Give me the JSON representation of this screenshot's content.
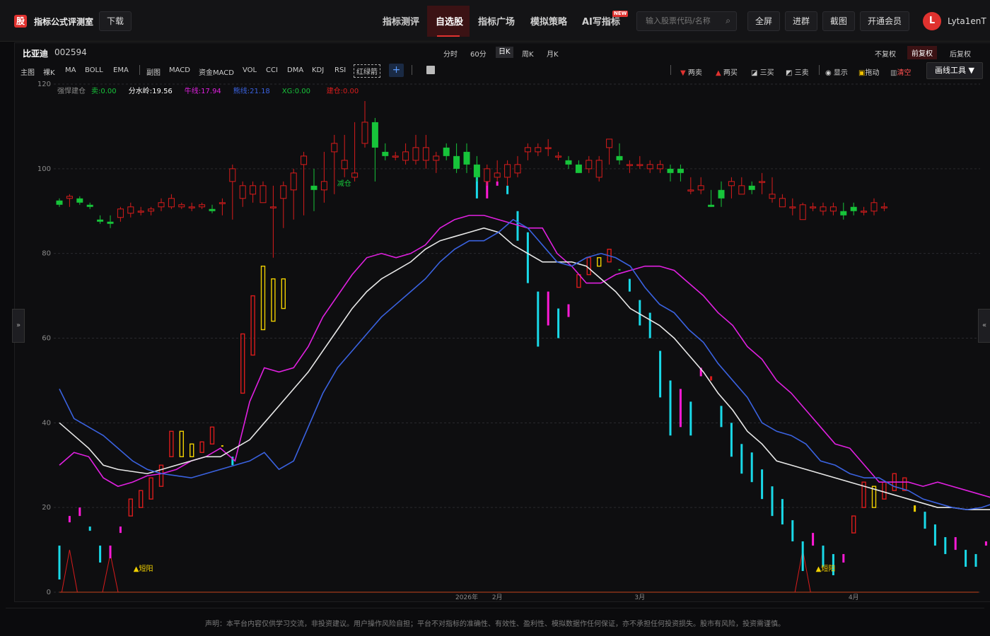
{
  "app": {
    "logo_char": "股",
    "title": "指标公式评测室",
    "download": "下载"
  },
  "nav": [
    {
      "label": "指标测评"
    },
    {
      "label": "自选股",
      "active": true
    },
    {
      "label": "指标广场"
    },
    {
      "label": "模拟策略"
    },
    {
      "label": "AI写指标",
      "badge": "NEW"
    }
  ],
  "search": {
    "placeholder": "输入股票代码/名称"
  },
  "top_actions": [
    "全屏",
    "进群",
    "截图",
    "开通会员"
  ],
  "user": {
    "avatar_letter": "L",
    "name": "Lyta1enT"
  },
  "stock": {
    "name": "比亚迪",
    "code": "002594"
  },
  "periods": [
    {
      "label": "分时"
    },
    {
      "label": "60分"
    },
    {
      "label": "日K",
      "active": true
    },
    {
      "label": "周K"
    },
    {
      "label": "月K"
    }
  ],
  "fuquan": [
    {
      "label": "不复权"
    },
    {
      "label": "前复权",
      "active": true
    },
    {
      "label": "后复权"
    }
  ],
  "indicators": [
    "主图",
    "裸K",
    "MA",
    "BOLL",
    "EMA",
    "副图",
    "MACD",
    "资金MACD",
    "VOL",
    "CCI",
    "DMA",
    "KDJ",
    "RSI",
    "红绿箭"
  ],
  "signal_tools": [
    "两卖",
    "两买",
    "三买",
    "三卖",
    "显示",
    "拖动",
    "清空"
  ],
  "draw_tool": "画线工具 ▼",
  "footer": "声明：本平台内容仅供学习交流，非投资建议。用户操作风险自担；平台不对指标的准确性、有效性、盈利性、模拟数据作任何保证，亦不承担任何投资损失。股市有风险，投资需谨慎。",
  "colors": {
    "up": "#d91c1c",
    "down": "#17c43a",
    "short": "#e020e0",
    "mid": "#e8e8e8",
    "long": "#3a62e0",
    "cyan": "#19d9e8",
    "magenta": "#ff1ad6",
    "yellow": "#f0d000",
    "accent": "#e0322f"
  },
  "chart_data": {
    "type": "line",
    "ylim": [
      0,
      120
    ],
    "yticks": [
      0,
      20,
      40,
      60,
      80,
      100,
      120
    ],
    "x_labels": [
      {
        "i": 40,
        "label": "2026年"
      },
      {
        "i": 43,
        "label": "2月"
      },
      {
        "i": 57,
        "label": "3月"
      },
      {
        "i": 78,
        "label": "4月"
      }
    ],
    "legend": [
      {
        "label": "强悍建仓",
        "value": "",
        "color": "#888888"
      },
      {
        "label": "卖:",
        "value": "0.00",
        "color": "#17c43a"
      },
      {
        "label": "分水岭:",
        "value": "19.56",
        "color": "#ffffff"
      },
      {
        "label": "牛线:",
        "value": "17.94",
        "color": "#e020e0"
      },
      {
        "label": "熊线:",
        "value": "21.18",
        "color": "#3a62e0"
      },
      {
        "label": "XG:",
        "value": "0.00",
        "color": "#17c43a"
      },
      {
        "label": "建仓:",
        "value": "0.00",
        "color": "#d91c1c"
      }
    ],
    "annotations": [
      {
        "i": 7,
        "y": 5,
        "text": "▲短阳",
        "color": "#f0d000"
      },
      {
        "i": 74,
        "y": 5,
        "text": "▲短阳",
        "color": "#f0d000"
      },
      {
        "i": 27,
        "y": 96,
        "text": "减仓",
        "color": "#17c43a"
      }
    ],
    "candles": {
      "o": [
        92.5,
        93,
        93,
        91.5,
        88,
        87.5,
        88.5,
        89.5,
        90,
        90,
        91,
        91,
        91,
        91,
        91,
        90.5,
        92,
        97,
        93,
        94,
        92,
        91,
        93,
        95,
        101,
        96,
        95,
        104,
        100,
        98,
        106,
        111,
        104,
        103,
        102,
        102,
        102,
        102,
        105,
        103,
        104,
        101,
        97,
        98,
        98,
        99,
        104,
        104,
        105,
        103,
        102,
        101,
        100,
        98,
        105,
        103,
        101,
        101,
        100,
        100,
        100,
        100,
        95,
        95,
        91.5,
        95,
        96,
        94,
        96,
        97,
        93,
        91,
        91,
        88,
        91,
        90,
        90,
        90,
        91,
        90,
        90,
        91
      ],
      "c": [
        91.5,
        93.5,
        92,
        91,
        87.5,
        87,
        90.5,
        91,
        90,
        90.5,
        92,
        93,
        91.5,
        91,
        91.5,
        90,
        92,
        100,
        96,
        96,
        96,
        91,
        96,
        99,
        103,
        95,
        97,
        106,
        102,
        99,
        111,
        105,
        103,
        103,
        104,
        105,
        105,
        103,
        103,
        100,
        101,
        98,
        100,
        99,
        101,
        101,
        105,
        105,
        105,
        103,
        101,
        99,
        102,
        102,
        107,
        102,
        101,
        101,
        101,
        101,
        99,
        99,
        95,
        96,
        91,
        93,
        97,
        96,
        95,
        97,
        94,
        93,
        91,
        91.5,
        91,
        91,
        91,
        89,
        90,
        90,
        92,
        91
      ],
      "h": [
        93,
        94,
        93.5,
        92,
        89,
        89,
        91,
        92,
        91,
        91,
        93,
        94,
        92,
        92,
        92,
        91.5,
        93,
        101,
        97,
        97,
        97,
        96,
        97,
        100,
        104,
        100,
        104,
        108,
        108,
        111,
        116,
        112,
        106,
        104,
        106,
        108,
        108,
        104,
        106,
        106,
        106,
        103,
        101,
        102,
        102,
        103,
        106,
        106,
        107,
        104,
        103,
        102,
        103,
        103,
        107,
        106,
        102,
        103,
        102,
        102,
        101,
        101,
        98,
        98,
        95,
        97,
        98,
        98,
        97,
        99,
        98,
        94,
        93,
        92,
        92,
        92,
        92,
        92,
        92,
        91,
        93,
        92
      ],
      "l": [
        91,
        91,
        91.5,
        90.5,
        87,
        86,
        87.5,
        88.5,
        89,
        89,
        90,
        90.5,
        90.5,
        90,
        90.5,
        89.5,
        89,
        88,
        91,
        92,
        92,
        79,
        86,
        88,
        89,
        90,
        92,
        94,
        98,
        97,
        105,
        97,
        102,
        102,
        101,
        101,
        100,
        99,
        102,
        99,
        99,
        97,
        96,
        97,
        96,
        98,
        102,
        103,
        103,
        102,
        100,
        99,
        99,
        97,
        101,
        101,
        99,
        100,
        99,
        99,
        97,
        97,
        94,
        94,
        91,
        91,
        93,
        94,
        94,
        94,
        92,
        91,
        89,
        88,
        90,
        89,
        89,
        88,
        89,
        89,
        89,
        90
      ]
    },
    "lines": [
      {
        "name": "牛线",
        "color": "#e020e0",
        "values": [
          30,
          33,
          32,
          27,
          25,
          26,
          27.5,
          28,
          29,
          31,
          32,
          34,
          31,
          45,
          53,
          52,
          53,
          58,
          65,
          70,
          75,
          79,
          80,
          79,
          80,
          82,
          86,
          88,
          89,
          89,
          88,
          87,
          86,
          86,
          80,
          77,
          73,
          73,
          75,
          76,
          77,
          77,
          76,
          73,
          70,
          66,
          63,
          58,
          55,
          50,
          47,
          43,
          39,
          35,
          34,
          30,
          26,
          26,
          26,
          25,
          26,
          25,
          24,
          23,
          22,
          21
        ]
      },
      {
        "name": "分水岭",
        "color": "#e8e8e8",
        "values": [
          40,
          37,
          34,
          30,
          29,
          28.5,
          28,
          29,
          30,
          31,
          32,
          32,
          34,
          36,
          40,
          44,
          48,
          52,
          57,
          62,
          67,
          71,
          74,
          76,
          78,
          81,
          83,
          84,
          85,
          86,
          85,
          82,
          80,
          78,
          78,
          78,
          77,
          74,
          71,
          67,
          65,
          63,
          60,
          56,
          52,
          47,
          43,
          38,
          35,
          31,
          30,
          29,
          28,
          27,
          26,
          25,
          24,
          23,
          22,
          21,
          20,
          20,
          19.5,
          19.5,
          19.5,
          19.5
        ]
      },
      {
        "name": "熊线",
        "color": "#3a62e0",
        "values": [
          48,
          41,
          39,
          37,
          34,
          31,
          29,
          28,
          27.5,
          27,
          28,
          29,
          30,
          31,
          33,
          29,
          31,
          39,
          47,
          53,
          57,
          61,
          65,
          68,
          71,
          74,
          78,
          81,
          83,
          83,
          85,
          88,
          86,
          82,
          78,
          77,
          79,
          80,
          79,
          77,
          72,
          68,
          66,
          62,
          59,
          54,
          50,
          46,
          40,
          38,
          37,
          35,
          31,
          30,
          28,
          27,
          27,
          25,
          24,
          22,
          21,
          20,
          19.5,
          20,
          21.18,
          20.5
        ]
      }
    ],
    "signal_bars": [
      {
        "i": 0,
        "y0": 3,
        "y1": 11,
        "color": "#19d9e8"
      },
      {
        "i": 1,
        "y0": 16.5,
        "y1": 18,
        "color": "#ff1ad6"
      },
      {
        "i": 2,
        "y0": 18,
        "y1": 20,
        "color": "#ff1ad6"
      },
      {
        "i": 3,
        "y0": 14.5,
        "y1": 15.5,
        "color": "#19d9e8"
      },
      {
        "i": 4,
        "y0": 7,
        "y1": 11,
        "color": "#19d9e8"
      },
      {
        "i": 5,
        "y0": 8,
        "y1": 11,
        "color": "#ff1ad6"
      },
      {
        "i": 6,
        "y0": 14,
        "y1": 15.5,
        "color": "#ff1ad6"
      },
      {
        "i": 7,
        "y0": 18,
        "y1": 22,
        "color": "#d91c1c",
        "hollow": true
      },
      {
        "i": 8,
        "y0": 20,
        "y1": 24,
        "color": "#d91c1c",
        "hollow": true
      },
      {
        "i": 9,
        "y0": 22,
        "y1": 27,
        "color": "#d91c1c",
        "hollow": true
      },
      {
        "i": 10,
        "y0": 25,
        "y1": 30,
        "color": "#d91c1c",
        "hollow": true
      },
      {
        "i": 11,
        "y0": 32,
        "y1": 38,
        "color": "#d91c1c",
        "hollow": true
      },
      {
        "i": 12,
        "y0": 32,
        "y1": 38,
        "color": "#f0d000",
        "hollow": true
      },
      {
        "i": 13,
        "y0": 32,
        "y1": 35,
        "color": "#f0d000",
        "hollow": true
      },
      {
        "i": 14,
        "y0": 33,
        "y1": 35.5,
        "color": "#d91c1c",
        "hollow": true
      },
      {
        "i": 15,
        "y0": 35,
        "y1": 39,
        "color": "#d91c1c",
        "hollow": true
      },
      {
        "i": 16,
        "y0": 34.5,
        "y1": 34.7,
        "color": "#f0d000"
      },
      {
        "i": 17,
        "y0": 30,
        "y1": 32,
        "color": "#19d9e8"
      },
      {
        "i": 18,
        "y0": 47,
        "y1": 61,
        "color": "#d91c1c",
        "hollow": true
      },
      {
        "i": 19,
        "y0": 56,
        "y1": 70,
        "color": "#d91c1c",
        "hollow": true
      },
      {
        "i": 20,
        "y0": 62,
        "y1": 77,
        "color": "#f0d000",
        "hollow": true
      },
      {
        "i": 21,
        "y0": 64,
        "y1": 74,
        "color": "#f0d000",
        "hollow": true
      },
      {
        "i": 22,
        "y0": 67,
        "y1": 74,
        "color": "#f0d000",
        "hollow": true
      },
      {
        "i": 41,
        "y0": 93,
        "y1": 98,
        "color": "#19d9e8"
      },
      {
        "i": 42,
        "y0": 93,
        "y1": 97,
        "color": "#ff1ad6"
      },
      {
        "i": 43,
        "y0": 96,
        "y1": 97,
        "color": "#ff1ad6"
      },
      {
        "i": 44,
        "y0": 94,
        "y1": 96,
        "color": "#19d9e8"
      },
      {
        "i": 45,
        "y0": 83,
        "y1": 90,
        "color": "#19d9e8"
      },
      {
        "i": 46,
        "y0": 73,
        "y1": 85,
        "color": "#19d9e8"
      },
      {
        "i": 47,
        "y0": 58,
        "y1": 71,
        "color": "#19d9e8"
      },
      {
        "i": 48,
        "y0": 63,
        "y1": 71,
        "color": "#ff1ad6"
      },
      {
        "i": 49,
        "y0": 60,
        "y1": 67,
        "color": "#19d9e8"
      },
      {
        "i": 50,
        "y0": 65,
        "y1": 68,
        "color": "#ff1ad6"
      },
      {
        "i": 51,
        "y0": 72,
        "y1": 75,
        "color": "#d91c1c",
        "hollow": true
      },
      {
        "i": 52,
        "y0": 75,
        "y1": 79,
        "color": "#d91c1c",
        "hollow": true
      },
      {
        "i": 53,
        "y0": 77,
        "y1": 79,
        "color": "#f0d000",
        "hollow": true
      },
      {
        "i": 54,
        "y0": 78,
        "y1": 81,
        "color": "#d91c1c",
        "hollow": true
      },
      {
        "i": 55,
        "y0": 76,
        "y1": 76.3,
        "color": "#17c43a"
      },
      {
        "i": 56,
        "y0": 71,
        "y1": 74,
        "color": "#19d9e8"
      },
      {
        "i": 57,
        "y0": 63,
        "y1": 69,
        "color": "#19d9e8"
      },
      {
        "i": 58,
        "y0": 60,
        "y1": 66,
        "color": "#19d9e8"
      },
      {
        "i": 59,
        "y0": 46,
        "y1": 57,
        "color": "#19d9e8"
      },
      {
        "i": 60,
        "y0": 37,
        "y1": 50,
        "color": "#19d9e8"
      },
      {
        "i": 61,
        "y0": 39,
        "y1": 48,
        "color": "#ff1ad6"
      },
      {
        "i": 62,
        "y0": 37,
        "y1": 45,
        "color": "#19d9e8"
      },
      {
        "i": 63,
        "y0": 51,
        "y1": 53,
        "color": "#ff1ad6"
      },
      {
        "i": 64,
        "y0": 50,
        "y1": 51,
        "color": "#d91c1c"
      },
      {
        "i": 65,
        "y0": 39,
        "y1": 44,
        "color": "#19d9e8"
      },
      {
        "i": 66,
        "y0": 32,
        "y1": 40,
        "color": "#19d9e8"
      },
      {
        "i": 67,
        "y0": 28,
        "y1": 35,
        "color": "#19d9e8"
      },
      {
        "i": 68,
        "y0": 26,
        "y1": 33,
        "color": "#19d9e8"
      },
      {
        "i": 69,
        "y0": 22,
        "y1": 29,
        "color": "#19d9e8"
      },
      {
        "i": 70,
        "y0": 18,
        "y1": 25,
        "color": "#19d9e8"
      },
      {
        "i": 71,
        "y0": 16,
        "y1": 22,
        "color": "#19d9e8"
      },
      {
        "i": 72,
        "y0": 12,
        "y1": 17,
        "color": "#19d9e8"
      },
      {
        "i": 73,
        "y0": 5,
        "y1": 12,
        "color": "#19d9e8"
      },
      {
        "i": 74,
        "y0": 11,
        "y1": 14,
        "color": "#ff1ad6"
      },
      {
        "i": 75,
        "y0": 6,
        "y1": 11,
        "color": "#19d9e8"
      },
      {
        "i": 76,
        "y0": 4,
        "y1": 9,
        "color": "#19d9e8"
      },
      {
        "i": 77,
        "y0": 7,
        "y1": 9,
        "color": "#ff1ad6"
      },
      {
        "i": 78,
        "y0": 14,
        "y1": 18,
        "color": "#d91c1c",
        "hollow": true
      },
      {
        "i": 79,
        "y0": 20,
        "y1": 26,
        "color": "#d91c1c",
        "hollow": true
      },
      {
        "i": 80,
        "y0": 20,
        "y1": 25,
        "color": "#f0d000",
        "hollow": true
      },
      {
        "i": 81,
        "y0": 22,
        "y1": 26,
        "color": "#d91c1c",
        "hollow": true
      },
      {
        "i": 82,
        "y0": 24,
        "y1": 28,
        "color": "#d91c1c",
        "hollow": true
      },
      {
        "i": 83,
        "y0": 24,
        "y1": 27,
        "color": "#d91c1c",
        "hollow": true
      },
      {
        "i": 84,
        "y0": 19,
        "y1": 20.5,
        "color": "#f0d000"
      },
      {
        "i": 85,
        "y0": 15,
        "y1": 19,
        "color": "#19d9e8"
      },
      {
        "i": 86,
        "y0": 11,
        "y1": 16,
        "color": "#19d9e8"
      },
      {
        "i": 87,
        "y0": 9,
        "y1": 13,
        "color": "#19d9e8"
      },
      {
        "i": 88,
        "y0": 10,
        "y1": 13,
        "color": "#ff1ad6"
      },
      {
        "i": 89,
        "y0": 6,
        "y1": 10,
        "color": "#19d9e8"
      },
      {
        "i": 90,
        "y0": 6,
        "y1": 9,
        "color": "#19d9e8"
      },
      {
        "i": 91,
        "y0": 11,
        "y1": 12,
        "color": "#ff1ad6"
      },
      {
        "i": 92,
        "y0": 12,
        "y1": 13,
        "color": "#ff1ad6"
      }
    ],
    "peaks": [
      {
        "i": 1,
        "h": 10
      },
      {
        "i": 5,
        "h": 9
      },
      {
        "i": 73,
        "h": 10
      }
    ]
  }
}
